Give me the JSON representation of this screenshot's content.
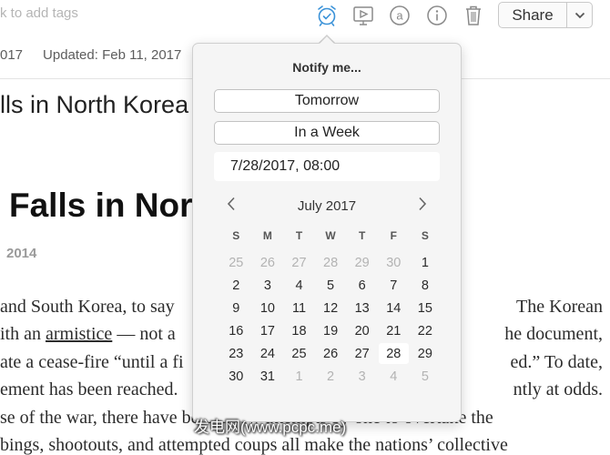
{
  "header": {
    "tag_placeholder": "k to add tags",
    "created_fragment": "017",
    "updated": "Updated: Feb 11, 2017",
    "share_label": "Share",
    "icons": [
      "alarm-clock-icon",
      "presentation-icon",
      "at-sign-icon",
      "info-icon",
      "trash-icon",
      "chevron-down-icon"
    ]
  },
  "note": {
    "title_fragment": "lls in North Korea",
    "heading_fragment": "Falls in Nor",
    "year_fragment": "2014",
    "left_lines": [
      "and South Korea, to say",
      "ith an",
      "ate a cease-fire “until a fi",
      "ement has been reached.",
      "se of the war, there have been a few attempts by one to overtake the",
      "bings, shootouts, and attempted coups all make the nations’ collective"
    ],
    "left_link": "armistice",
    "left_line2_tail": " — not a",
    "right_lines": [
      "The Korean",
      "he document,",
      "ed.” To date,",
      "ntly at odds."
    ]
  },
  "reminder": {
    "title": "Notify me...",
    "tomorrow_label": "Tomorrow",
    "week_label": "In a Week",
    "date_value": "7/28/2017, 08:00",
    "month_label": "July 2017",
    "weekdays": [
      "S",
      "M",
      "T",
      "W",
      "T",
      "F",
      "S"
    ],
    "selected_day": "28",
    "weeks": [
      [
        {
          "d": "25",
          "m": true
        },
        {
          "d": "26",
          "m": true
        },
        {
          "d": "27",
          "m": true
        },
        {
          "d": "28",
          "m": true
        },
        {
          "d": "29",
          "m": true
        },
        {
          "d": "30",
          "m": true
        },
        {
          "d": "1",
          "m": false
        }
      ],
      [
        {
          "d": "2",
          "m": false
        },
        {
          "d": "3",
          "m": false
        },
        {
          "d": "4",
          "m": false
        },
        {
          "d": "5",
          "m": false
        },
        {
          "d": "6",
          "m": false
        },
        {
          "d": "7",
          "m": false
        },
        {
          "d": "8",
          "m": false
        }
      ],
      [
        {
          "d": "9",
          "m": false
        },
        {
          "d": "10",
          "m": false
        },
        {
          "d": "11",
          "m": false
        },
        {
          "d": "12",
          "m": false
        },
        {
          "d": "13",
          "m": false
        },
        {
          "d": "14",
          "m": false
        },
        {
          "d": "15",
          "m": false
        }
      ],
      [
        {
          "d": "16",
          "m": false
        },
        {
          "d": "17",
          "m": false
        },
        {
          "d": "18",
          "m": false
        },
        {
          "d": "19",
          "m": false
        },
        {
          "d": "20",
          "m": false
        },
        {
          "d": "21",
          "m": false
        },
        {
          "d": "22",
          "m": false
        }
      ],
      [
        {
          "d": "23",
          "m": false
        },
        {
          "d": "24",
          "m": false
        },
        {
          "d": "25",
          "m": false
        },
        {
          "d": "26",
          "m": false
        },
        {
          "d": "27",
          "m": false
        },
        {
          "d": "28",
          "m": false
        },
        {
          "d": "29",
          "m": false
        }
      ],
      [
        {
          "d": "30",
          "m": false
        },
        {
          "d": "31",
          "m": false
        },
        {
          "d": "1",
          "m": true
        },
        {
          "d": "2",
          "m": true
        },
        {
          "d": "3",
          "m": true
        },
        {
          "d": "4",
          "m": true
        },
        {
          "d": "5",
          "m": true
        }
      ]
    ]
  },
  "watermark": "发电网(www.pcpc.me)",
  "colors": {
    "accent": "#3a92d8",
    "icon_gray": "#8a8a8a",
    "popover_bg": "#f5f5f5"
  }
}
